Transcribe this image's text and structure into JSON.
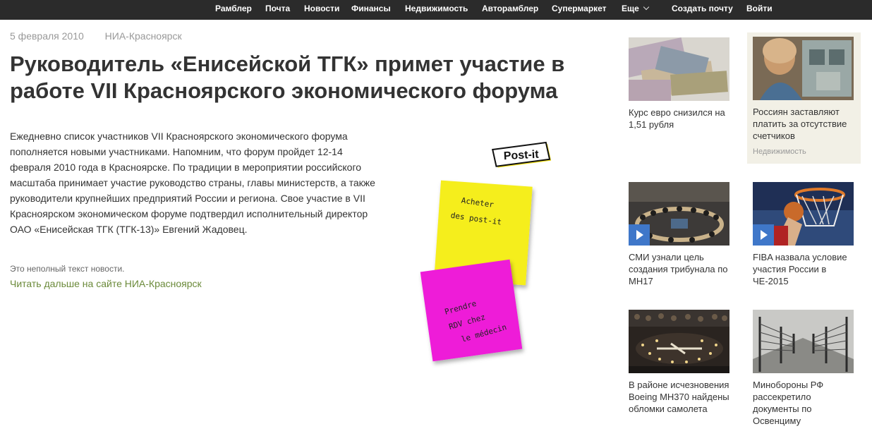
{
  "nav": {
    "items": [
      "Рамблер",
      "Почта",
      "Новости",
      "Финансы",
      "Недвижимость",
      "Авторамблер",
      "Супермаркет",
      "Еще"
    ],
    "create_mail": "Создать почту",
    "login": "Войти"
  },
  "article": {
    "date": "5 февраля 2010",
    "source": "НИА-Красноярск",
    "headline": "Руководитель «Енисейской ТГК» примет участие в работе VII Красноярского экономического форума",
    "body": "Ежедневно список участников VII Красноярского экономического форума пополняется новыми участниками. Напомним, что форум пройдет 12-14 февраля 2010 года в Красноярске. По традиции в мероприятии российского масштаба принимает участие руководство страны, главы министерств, а также руководители крупнейших предприятий России и региона. Свое участие в VII Красноярском экономическом форуме подтвердил исполнительный директор ОАО «Енисейская ТГК (ТГК-13)» Евгений Жадовец.",
    "incomplete_note": "Это неполный текст новости.",
    "read_more": "Читать дальше на сайте НИА-Красноярск"
  },
  "ad": {
    "brand": "Post-it",
    "note1": "Acheter des post-it",
    "note2": "Prendre RDV chez le médecin"
  },
  "sidebar": {
    "cards": [
      {
        "title": "Курс евро снизился на 1,51 рубля",
        "tag": "",
        "video": false
      },
      {
        "title": "Россиян заставляют платить за отсутствие счетчиков",
        "tag": "Недвижимость",
        "video": false
      },
      {
        "title": "СМИ узнали цель создания трибунала по MH17",
        "tag": "",
        "video": true
      },
      {
        "title": "FIBA назвала условие участия России в ЧЕ-2015",
        "tag": "",
        "video": true
      },
      {
        "title": "В районе исчезновения Boeing MH370 найдены обломки самолета",
        "tag": "",
        "video": false
      },
      {
        "title": "Минобороны РФ рассекретило документы по Освенциму",
        "tag": "",
        "video": false
      }
    ]
  },
  "colors": {
    "topbar": "#2b2b2b",
    "link_green": "#6b8a3a",
    "play_blue": "#3f77c9",
    "highlight_bg": "#f2f0e6",
    "note_yellow": "#f5ee1f",
    "note_pink": "#ee1ed8"
  }
}
